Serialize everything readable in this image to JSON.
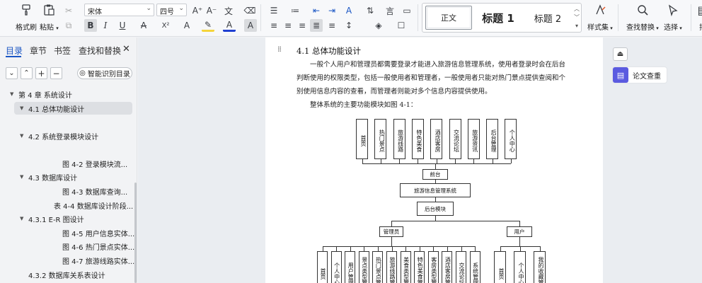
{
  "ribbon": {
    "format_painter": "格式刷",
    "paste": "粘贴",
    "font_name": "宋体",
    "font_size": "四号",
    "style_normal": "正文",
    "style_h1": "标题 1",
    "style_h2": "标题 2",
    "style_set": "样式集",
    "find_replace": "查找替换",
    "select": "选择",
    "layout_partial": "排",
    "bold": "B",
    "italic": "I",
    "underline": "U",
    "strike": "A",
    "superscript": "X²",
    "font_color_letter": "A",
    "char_shade": "A",
    "grow_font": "A⁺",
    "shrink_font": "A⁻"
  },
  "nav": {
    "tabs": [
      "目录",
      "章节",
      "书签",
      "查找和替换"
    ],
    "smart_toc": "智能识别目录",
    "items": [
      {
        "label": "第 4 章   系统设计"
      },
      {
        "label": "4.1   总体功能设计"
      },
      {
        "label": "4.2   系统登录模块设计"
      },
      {
        "label": "图 4-2   登录模块流..."
      },
      {
        "label": "4.3   数据库设计"
      },
      {
        "label": "图 4-3   数据库查询..."
      },
      {
        "label": "表 4-4   数据库设计阶段..."
      },
      {
        "label": "4.3.1   E-R 图设计"
      },
      {
        "label": "图 4-5 用户信息实体..."
      },
      {
        "label": "图 4-6 热门景点实体..."
      },
      {
        "label": "图 4-7 旅游线路实体..."
      },
      {
        "label": "4.3.2   数据库关系表设计"
      }
    ]
  },
  "doc": {
    "heading": "4.1   总体功能设计",
    "lines": [
      "一般个人用户和管理员都需要登录才能进入旅游信息管理系统，使用者登录时会在后台",
      "判断使用的权限类型，包括一般使用者和管理者，一般使用者只能对热门景点提供查阅和个",
      "别使用信息内容的查看，而管理者则能对多个信息内容提供使用。",
      "整体系统的主要功能模块如图 4-1："
    ],
    "diagram": {
      "top_modules": [
        "首页",
        "热门景点",
        "旅游线路",
        "特色美食",
        "酒店客房",
        "交流论坛",
        "旅游资讯",
        "后台管理",
        "个人中心"
      ],
      "front": "前台",
      "system": "旅游信息管理系统",
      "back": "后台模块",
      "admin": "管理员",
      "user": "用户",
      "admin_modules": [
        "首页",
        "个人中心",
        "用户管理",
        "景点类型管理",
        "热门景点管理",
        "旅游线路管理",
        "美食类型管理",
        "特色美食管理",
        "客房类型管理",
        "酒店客房管理",
        "交流论坛",
        "系统管理"
      ],
      "user_modules": [
        "首页",
        "个人中心",
        "我的收藏管理"
      ]
    }
  },
  "right_panel": {
    "paper_check": "论文查重"
  }
}
